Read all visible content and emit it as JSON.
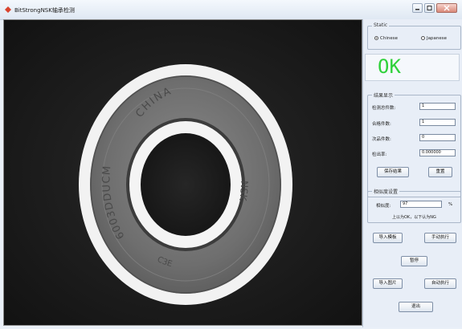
{
  "window": {
    "title": "BitStrongNSK轴承检测"
  },
  "panel": {
    "static_group": {
      "title": "Static",
      "options": [
        "Chinese",
        "Japanese"
      ],
      "selected": "Chinese"
    },
    "status": {
      "text": "OK",
      "color": "#2fd13a"
    },
    "results": {
      "title": "结果显示",
      "fields": [
        {
          "label": "检测总件数:",
          "value": "1"
        },
        {
          "label": "合格件数:",
          "value": "1"
        },
        {
          "label": "次品件数:",
          "value": "0"
        },
        {
          "label": "检出率:",
          "value": "0.000000"
        }
      ],
      "save_label": "保存结果",
      "reset_label": "重置"
    },
    "similarity": {
      "title": "相似度设置",
      "label": "相似度:",
      "value": "97",
      "unit": "%",
      "note": "上以为OK，以下认为NG"
    },
    "buttons": {
      "import_template": "导入模板",
      "manual_run": "手动执行",
      "pause": "暂停",
      "import_image": "导入图片",
      "auto_run": "自动执行",
      "exit": "退出"
    }
  },
  "bearing": {
    "top_text": "CHINA",
    "left_text": "6003DDUCM",
    "right_text": "NSK",
    "bottom_text": "C3E"
  },
  "colors": {
    "panel_bg": "#e8eef7",
    "image_bg": "#171717",
    "ok_green": "#2fd13a"
  }
}
